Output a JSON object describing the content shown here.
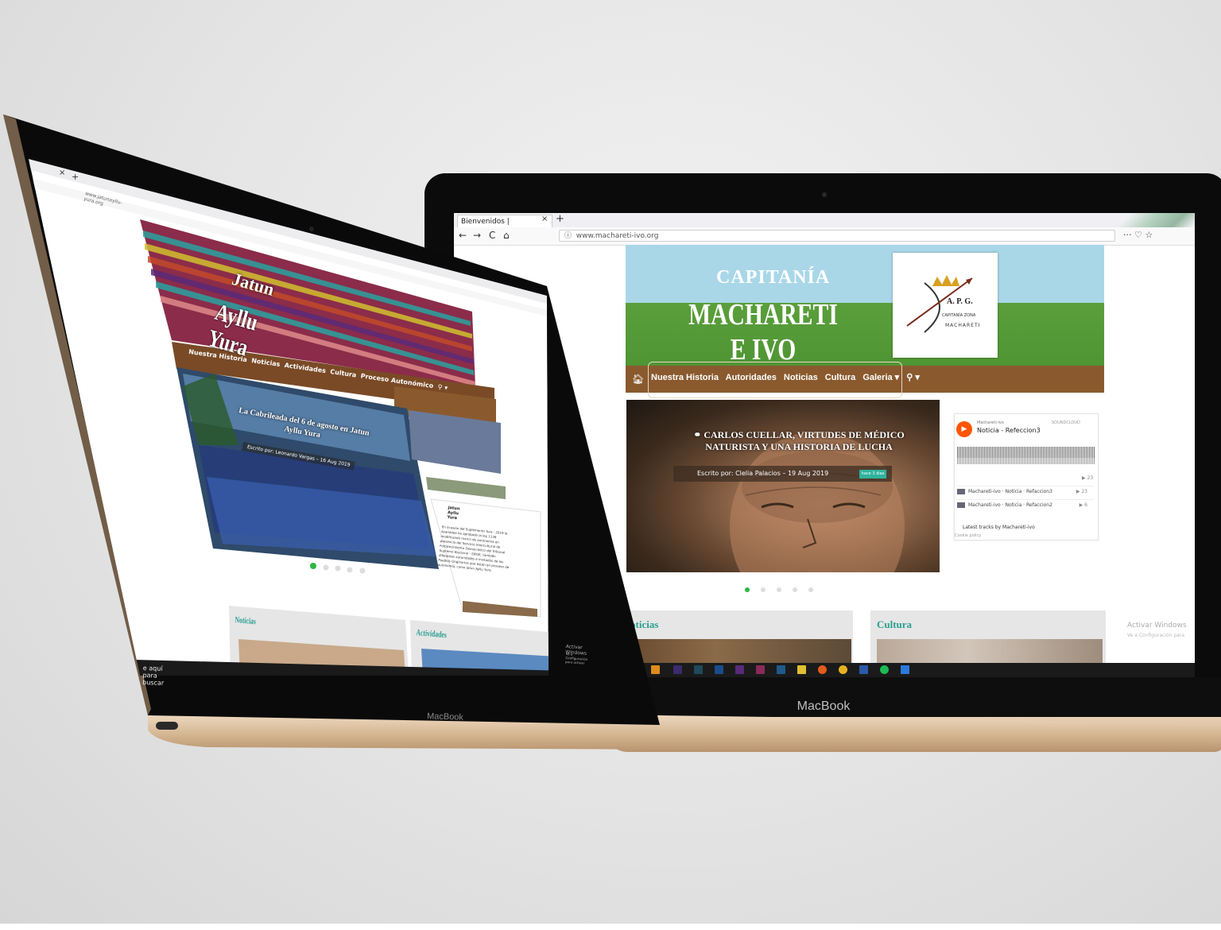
{
  "device_brand": "MacBook",
  "right_screen": {
    "browser": {
      "tab_title": "Bienvenidos |",
      "url": "www.machareti-ivo.org",
      "nav_back": "←",
      "nav_forward": "→",
      "nav_reload": "C",
      "nav_home": "⌂",
      "tab_close": "×",
      "new_tab": "+",
      "menu_icons": "··· ♡ ☆"
    },
    "site": {
      "header_line1": "CAPITANÍA",
      "header_line2": "MACHARETI E IVO",
      "logo_apg": "A. P. G.",
      "logo_sub": "CAPITANÍA ZONA",
      "logo_place": "MACHARETI",
      "nav_items": [
        "Nuestra Historia",
        "Autoridades",
        "Noticias",
        "Cultura",
        "Galeria ▾",
        "⚲ ▾"
      ],
      "slide_title": "CARLOS CUELLAR, VIRTUDES DE MÉDICO NATURISTA Y UNA HISTORIA DE LUCHA",
      "slide_meta": "Escrito por: Clelia Palacios – 19 Aug 2019",
      "slide_badge": "hace 3 dias",
      "soundcloud": {
        "user": "Machareti-ivo",
        "track": "Noticia - Refeccion3",
        "brand": "SOUNDCLOUD",
        "plays": "▶ 23",
        "rows": [
          {
            "title": "Machareti-ivo · Noticia · Refaccion3",
            "plays": "▶ 23"
          },
          {
            "title": "Machareti-ivo · Noticia · Refaccion2",
            "plays": "▶ 6"
          }
        ],
        "footer": "Latest tracks by Machareti-ivo",
        "footer2": "Cookie policy"
      },
      "cards": [
        "oticias",
        "Cultura"
      ],
      "activate_title": "Activar Windows",
      "activate_sub": "Ve a Configuración para"
    }
  },
  "left_screen": {
    "browser": {
      "url": "www.jatunayllu-yura.org",
      "tab_close": "×",
      "new_tab": "+"
    },
    "site": {
      "header_line1": "Jatun",
      "header_line2": "Ayllu Yura",
      "nav_items": [
        "Nuestra Historia",
        "Noticias",
        "Actividades",
        "Cultura",
        "Proceso Autonómico",
        "⚲ ▾"
      ],
      "slide_title": "La Cabrileada del 6 de agosto en Jatun Ayllu Yura",
      "slide_meta": "Escrito por: Leonardo Vargas – 16 Aug 2019",
      "fb_page": "Jatun Ayllu Yura",
      "fb_post": "En ocasión del Suplemento Yura · 2019 la Asamblea ha aprobado la ley 1138 modificando marco de autonomía en presencia del Servicio Intercultural de Fortalecimiento Democrático del Tribunal Supremo Electoral - SIFDE, también diferentes autoridades e invitados de los Pueblos Originarios que están en proceso de autonomía, como Jatun Ayllu Yura.",
      "cards": [
        "Noticias",
        "Actividades"
      ],
      "activate_title": "Activar Windows",
      "activate_sub": "Ve a Configuración para activar",
      "search_placeholder": "e aquí para buscar"
    }
  },
  "colors": {
    "green_dot": "#2db742",
    "brown_nav": "#8a5a2e",
    "teal": "#2a9f90",
    "sky": "#a9d7e8",
    "grass": "#4f9534"
  }
}
